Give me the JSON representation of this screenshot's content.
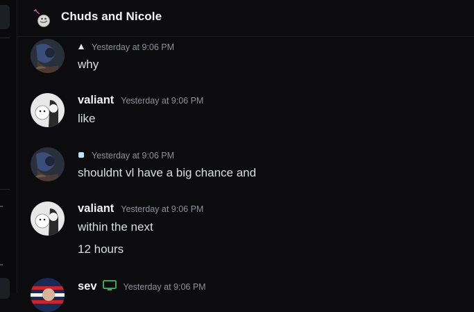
{
  "channel": {
    "title": "Chuds and Nicole"
  },
  "messages": [
    {
      "username": "",
      "time": "Yesterday at 9:06 PM",
      "text": [
        "why"
      ]
    },
    {
      "username": "valiant",
      "time": "Yesterday at 9:06 PM",
      "text": [
        "like"
      ]
    },
    {
      "username": "",
      "time": "Yesterday at 9:06 PM",
      "text": [
        "shouldnt vl have a big chance and"
      ]
    },
    {
      "username": "valiant",
      "time": "Yesterday at 9:06 PM",
      "text": [
        "within the next",
        "12 hours"
      ]
    },
    {
      "username": "sev",
      "time": "Yesterday at 9:06 PM",
      "text": []
    }
  ],
  "colors": {
    "background": "#0c0c0f",
    "accent_green": "#3ba55c"
  },
  "icons": [
    "group-dm-icon",
    "server-tag-icon",
    "monitor-icon"
  ]
}
